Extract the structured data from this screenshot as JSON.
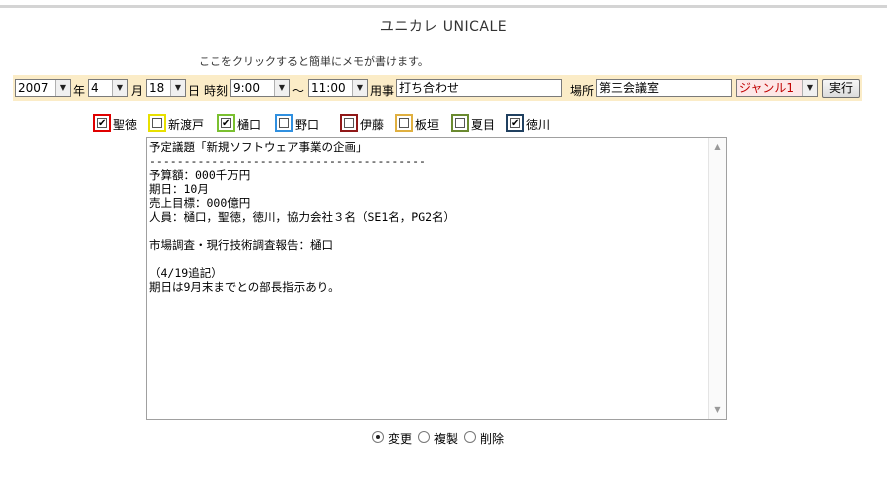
{
  "title": "ユニカレ UNICALE",
  "memo_link": "ここをクリックすると簡単にメモが書けます。",
  "form": {
    "year": "2007",
    "year_unit": "年",
    "month": "4",
    "month_unit": "月",
    "day": "18",
    "day_unit": "日",
    "time_label": "時刻",
    "start_time": "9:00",
    "tilde": "～",
    "end_time": "11:00",
    "subject_label": "用事",
    "subject_value": "打ち合わせ",
    "place_label": "場所",
    "place_value": "第三会議室",
    "genre": "ジャンル1",
    "execute": "実行"
  },
  "members": [
    {
      "name": "聖徳",
      "checked": true,
      "color": "#e00000"
    },
    {
      "name": "新渡戸",
      "checked": false,
      "color": "#e8e000"
    },
    {
      "name": "樋口",
      "checked": true,
      "color": "#7ac030"
    },
    {
      "name": "野口",
      "checked": false,
      "color": "#3090e0"
    },
    {
      "name": "伊藤",
      "checked": false,
      "color": "#901818"
    },
    {
      "name": "板垣",
      "checked": false,
      "color": "#e0b040"
    },
    {
      "name": "夏目",
      "checked": false,
      "color": "#6a8a30"
    },
    {
      "name": "徳川",
      "checked": true,
      "color": "#204060"
    }
  ],
  "memo": "予定議題「新規ソフトウェア事業の企画」\n----------------------------------------\n予算額：000千万円\n期日：10月\n売上目標：000億円\n人員：樋口，聖徳，徳川，協力会社３名（SE1名，PG2名）\n\n市場調査・現行技術調査報告：樋口\n\n（4/19追記）\n期日は9月末までとの部長指示あり。",
  "actions": [
    {
      "label": "変更",
      "selected": true
    },
    {
      "label": "複製",
      "selected": false
    },
    {
      "label": "削除",
      "selected": false
    }
  ]
}
